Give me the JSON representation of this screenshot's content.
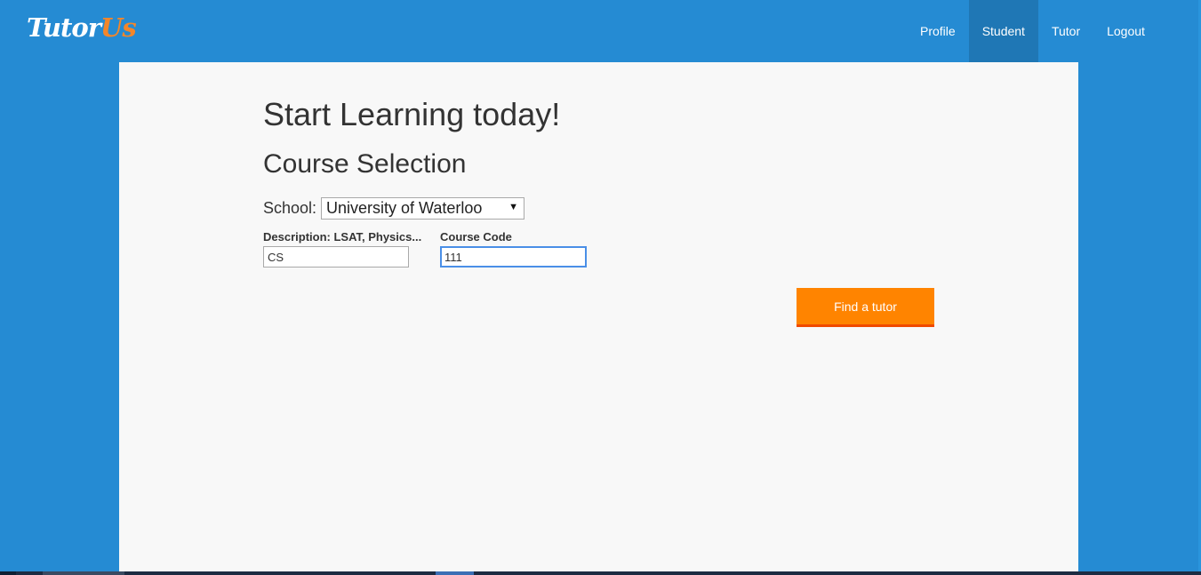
{
  "app": {
    "logo_main": "Tutor",
    "logo_accent": "Us"
  },
  "nav": {
    "items": [
      {
        "label": "Profile",
        "active": false
      },
      {
        "label": "Student",
        "active": true
      },
      {
        "label": "Tutor",
        "active": false
      },
      {
        "label": "Logout",
        "active": false
      }
    ]
  },
  "main": {
    "title": "Start Learning today!",
    "subtitle": "Course Selection",
    "school_label": "School:",
    "school_selected": "University of Waterloo",
    "description_label": "Description: LSAT, Physics...",
    "description_value": "CS",
    "course_code_label": "Course Code",
    "course_code_value": "111",
    "submit_label": "Find a tutor"
  },
  "colors": {
    "brand": "#258bd3",
    "nav_active": "#1f77b5",
    "accent": "#ff8400",
    "accent_border": "#f04a00",
    "logo_accent": "#f3862a",
    "content_bg": "#f8f8f8"
  }
}
